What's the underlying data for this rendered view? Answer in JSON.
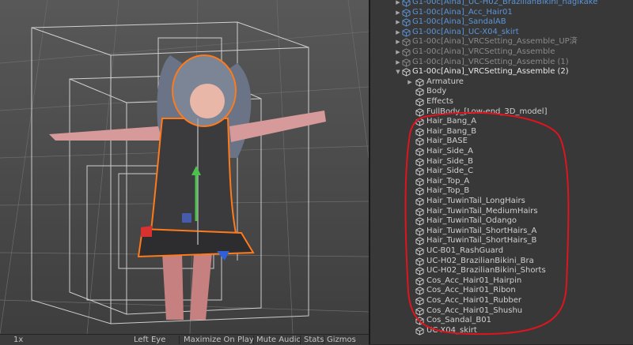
{
  "scene": {
    "bottom_bar": {
      "scale": "1x",
      "display": "Left Eye",
      "maximize": "Maximize On Play",
      "mute": "Mute Audio",
      "stats": "Stats",
      "gizmos": "Gizmos"
    }
  },
  "hierarchy": {
    "items": [
      {
        "label": "G1-00c[Aina]_UC-H02_BrazilianBikini_hagikake",
        "style": "blue",
        "arrow": "right",
        "indent": 0
      },
      {
        "label": "G1-00c[Aina]_Acc_Hair01",
        "style": "blue",
        "arrow": "right",
        "indent": 0
      },
      {
        "label": "G1-00c[Aina]_SandalAB",
        "style": "blue",
        "arrow": "right",
        "indent": 0
      },
      {
        "label": "G1-00c[Aina]_UC-X04_skirt",
        "style": "blue",
        "arrow": "right",
        "indent": 0
      },
      {
        "label": "G1-00c[Aina]_VRCSetting_Assemble_UP済",
        "style": "grey",
        "arrow": "right",
        "indent": 0
      },
      {
        "label": "G1-00c[Aina]_VRCSetting_Assemble",
        "style": "grey",
        "arrow": "right",
        "indent": 0
      },
      {
        "label": "G1-00c[Aina]_VRCSetting_Assemble (1)",
        "style": "grey",
        "arrow": "right",
        "indent": 0
      },
      {
        "label": "G1-00c[Aina]_VRCSetting_Assemble (2)",
        "style": "sel",
        "arrow": "down",
        "indent": 0
      },
      {
        "label": "Armature",
        "style": "norm",
        "arrow": "right",
        "indent": 1
      },
      {
        "label": "Body",
        "style": "norm",
        "arrow": "",
        "indent": 1
      },
      {
        "label": "Effects",
        "style": "norm",
        "arrow": "",
        "indent": 1
      },
      {
        "label": "FullBody_[Low-end_3D_model]",
        "style": "norm",
        "arrow": "",
        "indent": 1
      },
      {
        "label": "Hair_Bang_A",
        "style": "norm",
        "arrow": "",
        "indent": 1
      },
      {
        "label": "Hair_Bang_B",
        "style": "norm",
        "arrow": "",
        "indent": 1
      },
      {
        "label": "Hair_BASE",
        "style": "norm",
        "arrow": "",
        "indent": 1
      },
      {
        "label": "Hair_Side_A",
        "style": "norm",
        "arrow": "",
        "indent": 1
      },
      {
        "label": "Hair_Side_B",
        "style": "norm",
        "arrow": "",
        "indent": 1
      },
      {
        "label": "Hair_Side_C",
        "style": "norm",
        "arrow": "",
        "indent": 1
      },
      {
        "label": "Hair_Top_A",
        "style": "norm",
        "arrow": "",
        "indent": 1
      },
      {
        "label": "Hair_Top_B",
        "style": "norm",
        "arrow": "",
        "indent": 1
      },
      {
        "label": "Hair_TuwinTail_LongHairs",
        "style": "norm",
        "arrow": "",
        "indent": 1
      },
      {
        "label": "Hair_TuwinTail_MediumHairs",
        "style": "norm",
        "arrow": "",
        "indent": 1
      },
      {
        "label": "Hair_TuwinTail_Odango",
        "style": "norm",
        "arrow": "",
        "indent": 1
      },
      {
        "label": "Hair_TuwinTail_ShortHairs_A",
        "style": "norm",
        "arrow": "",
        "indent": 1
      },
      {
        "label": "Hair_TuwinTail_ShortHairs_B",
        "style": "norm",
        "arrow": "",
        "indent": 1
      },
      {
        "label": "UC-B01_RashGuard",
        "style": "norm",
        "arrow": "",
        "indent": 1
      },
      {
        "label": "UC-H02_BrazilianBikini_Bra",
        "style": "norm",
        "arrow": "",
        "indent": 1
      },
      {
        "label": "UC-H02_BrazilianBikini_Shorts",
        "style": "norm",
        "arrow": "",
        "indent": 1
      },
      {
        "label": "Cos_Acc_Hair01_Hairpin",
        "style": "norm",
        "arrow": "",
        "indent": 1
      },
      {
        "label": "Cos_Acc_Hair01_Ribon",
        "style": "norm",
        "arrow": "",
        "indent": 1
      },
      {
        "label": "Cos_Acc_Hair01_Rubber",
        "style": "norm",
        "arrow": "",
        "indent": 1
      },
      {
        "label": "Cos_Acc_Hair01_Shushu",
        "style": "norm",
        "arrow": "",
        "indent": 1
      },
      {
        "label": "Cos_Sandal_B01",
        "style": "norm",
        "arrow": "",
        "indent": 1
      },
      {
        "label": "UC-X04_skirt",
        "style": "norm",
        "arrow": "",
        "indent": 1
      }
    ]
  },
  "colors": {
    "prefab_blue": "#5b94d8",
    "inactive_grey": "#8a8a8a",
    "selection_outline": "#ff7a1a",
    "annotation_red": "#e0141e"
  },
  "icons": [
    "cube-icon",
    "prefab-cube-icon",
    "expand-arrow-icon",
    "collapse-arrow-icon"
  ]
}
